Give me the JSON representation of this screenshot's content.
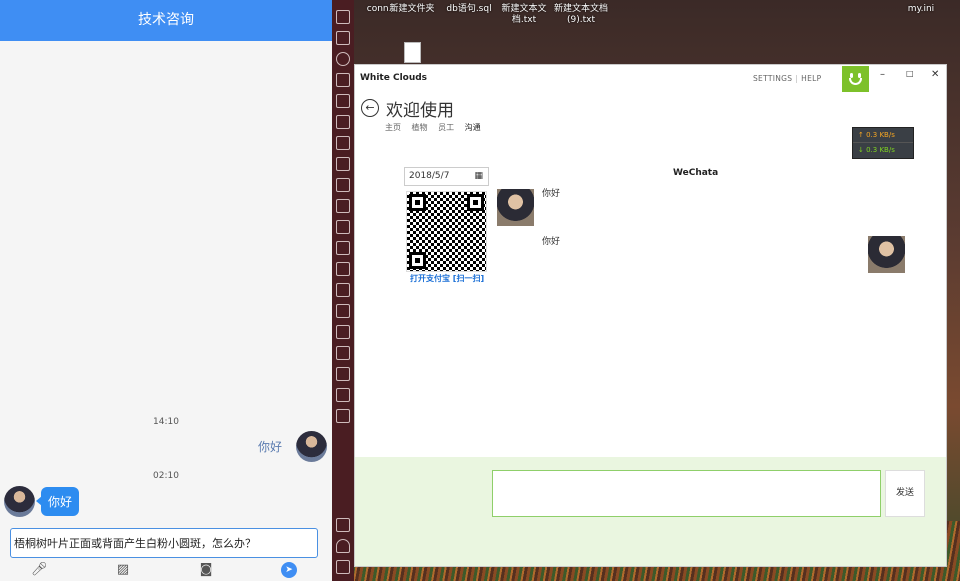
{
  "phone": {
    "title": "技术咨询",
    "messages": [
      {
        "time": "14:10",
        "text": "你好",
        "side": "right"
      },
      {
        "time": "02:10",
        "text": "你好",
        "side": "left"
      }
    ],
    "input_value": "梧桐树叶片正面或背面产生白粉小圆斑，怎么办？",
    "tools": [
      "mic-icon",
      "image-icon",
      "camera-icon",
      "send-icon"
    ]
  },
  "desktop": {
    "icons": [
      "conn...",
      "新建文件夹",
      "db语句.sql",
      "新建文本文\n档.txt",
      "新建文本文档\n(9).txt",
      "my.ini"
    ]
  },
  "window": {
    "title": "White Clouds",
    "menu": {
      "settings": "SETTINGS",
      "help": "HELP"
    },
    "controls": {
      "minimize": "–",
      "maximize": "□",
      "close": "✕"
    },
    "heading": "欢迎使用",
    "breadcrumbs": [
      "主页",
      "植物",
      "员工",
      "沟通"
    ],
    "netspeed": {
      "up": "↑ 0.3 KB/s",
      "down": "↓ 0.3 KB/s"
    },
    "date_value": "2018/5/7",
    "qr_caption": "打开支付宝 [扫一扫]",
    "chat_title": "WeChata",
    "chat_messages": [
      {
        "text": "你好",
        "side": "left"
      },
      {
        "text": "你好",
        "side": "right"
      }
    ],
    "send_label": "发送"
  }
}
